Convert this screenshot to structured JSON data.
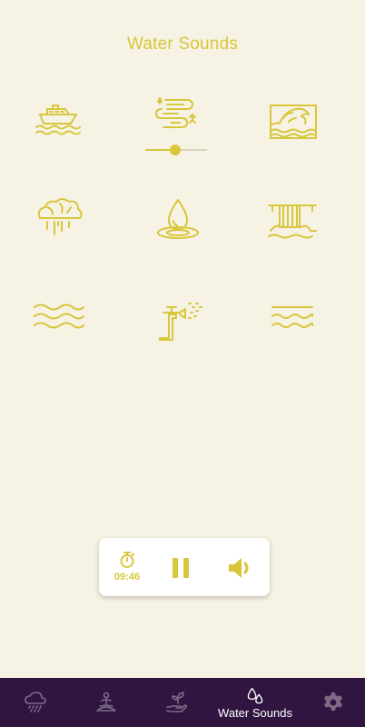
{
  "page": {
    "title": "Water Sounds"
  },
  "colors": {
    "accent": "#d8c63c",
    "background": "#f7f3e4",
    "navbar": "#2f1540",
    "nav_inactive": "#7d6b86",
    "nav_active": "#ffffff"
  },
  "sounds": [
    {
      "icon": "ship-icon"
    },
    {
      "icon": "river-stream-icon",
      "volume": 0.48
    },
    {
      "icon": "ocean-waves-icon"
    },
    {
      "icon": "rain-cloud-icon"
    },
    {
      "icon": "water-drop-icon"
    },
    {
      "icon": "waterfall-icon"
    },
    {
      "icon": "lake-waves-icon"
    },
    {
      "icon": "garden-hose-icon"
    },
    {
      "icon": "sea-waves-icon"
    }
  ],
  "player": {
    "timer_icon": "stopwatch-icon",
    "timer": "09:46",
    "pause_icon": "pause-icon",
    "volume_icon": "speaker-icon"
  },
  "nav": {
    "items": [
      {
        "icon": "rain-icon"
      },
      {
        "icon": "meditation-icon"
      },
      {
        "icon": "plant-hand-icon"
      },
      {
        "icon": "water-drops-icon",
        "label": "Water Sounds",
        "active": true
      },
      {
        "icon": "gear-icon"
      }
    ]
  }
}
